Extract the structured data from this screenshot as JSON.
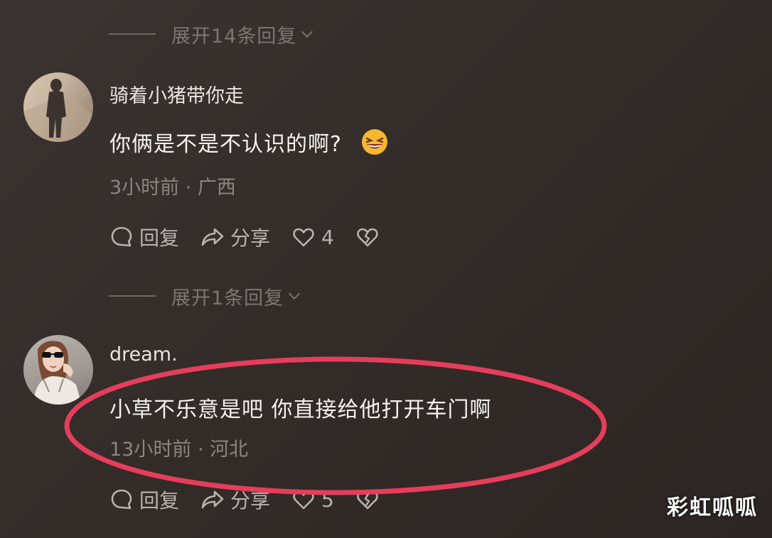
{
  "thread1": {
    "expand_label": "展开14条回复"
  },
  "comment1": {
    "username": "骑着小猪带你走",
    "text": "你俩是不是不认识的啊?",
    "meta": "3小时前 · 广西",
    "reply_label": "回复",
    "share_label": "分享",
    "likes": "4"
  },
  "thread2": {
    "expand_label": "展开1条回复"
  },
  "comment2": {
    "username": "dream.",
    "text": "小草不乐意是吧 你直接给他打开车门啊",
    "meta": "13小时前 · 河北",
    "reply_label": "回复",
    "share_label": "分享",
    "likes": "5"
  },
  "watermark": "彩虹呱呱",
  "colors": {
    "highlight": "#e63e5a",
    "emoji": "#f6b731"
  },
  "icons": [
    "comment-bubble-icon",
    "share-arrow-icon",
    "heart-icon",
    "broken-heart-icon",
    "chevron-down-icon",
    "laughing-emoji-icon"
  ]
}
